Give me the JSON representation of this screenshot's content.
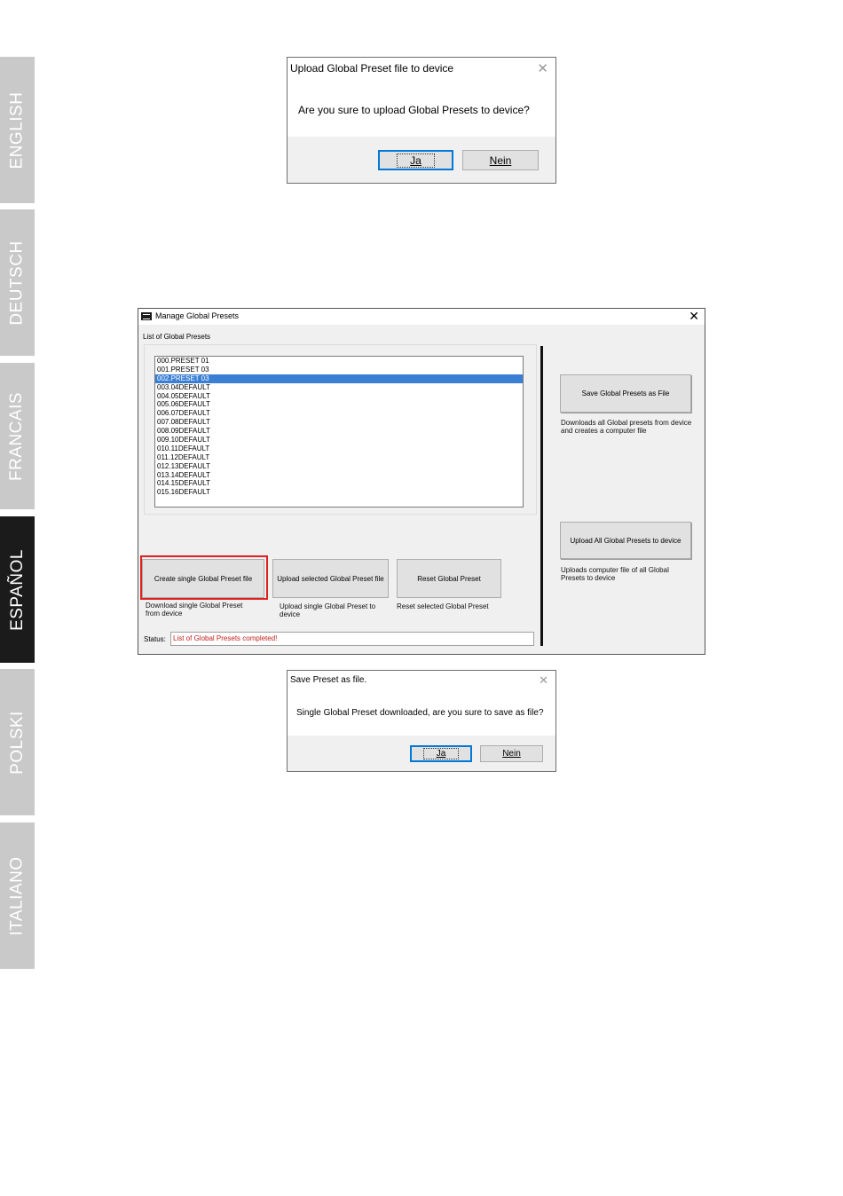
{
  "language_tabs": [
    {
      "label": "ENGLISH",
      "active": false
    },
    {
      "label": "DEUTSCH",
      "active": false
    },
    {
      "label": "FRANCAIS",
      "active": false
    },
    {
      "label": "ESPAÑOL",
      "active": true
    },
    {
      "label": "POLSKI",
      "active": false
    },
    {
      "label": "ITALIANO",
      "active": false
    }
  ],
  "upload_dialog": {
    "title": "Upload Global Preset file to device",
    "message": "Are you sure to upload Global Presets to device?",
    "yes_label": "Ja",
    "no_label": "Nein"
  },
  "manage_window": {
    "title": "Manage Global Presets",
    "list_label": "List of Global Presets",
    "presets": [
      "000.PRESET 01",
      "001.PRESET 03",
      "002.PRESET 03",
      "003.04DEFAULT",
      "004.05DEFAULT",
      "005.06DEFAULT",
      "006.07DEFAULT",
      "007.08DEFAULT",
      "008.09DEFAULT",
      "009.10DEFAULT",
      "010.11DEFAULT",
      "011.12DEFAULT",
      "012.13DEFAULT",
      "013.14DEFAULT",
      "014.15DEFAULT",
      "015.16DEFAULT"
    ],
    "selected_index": 2,
    "save_all_button": "Save Global Presets as File",
    "save_all_desc": "Downloads all Global presets from device and creates a computer file",
    "upload_all_button": "Upload All Global Presets to device",
    "upload_all_desc": "Uploads computer file of all Global Presets to device",
    "create_single_button": "Create single Global Preset file",
    "create_single_desc": "Download single Global Preset from device",
    "upload_selected_button": "Upload selected Global Preset file",
    "upload_selected_desc": "Upload single Global Preset to device",
    "reset_button": "Reset Global Preset",
    "reset_desc": "Reset selected Global Preset",
    "status_label": "Status:",
    "status_value": "List of Global Presets completed!"
  },
  "save_dialog": {
    "title": "Save Preset as file.",
    "message": "Single Global Preset downloaded, are you sure to save as file?",
    "yes_label": "Ja",
    "no_label": "Nein"
  },
  "colors": {
    "tab_inactive": "#c9c9c9",
    "tab_active": "#1b1b1b",
    "selection": "#3a7fd4",
    "highlight": "#e0201f",
    "status_text": "#c0211f"
  }
}
